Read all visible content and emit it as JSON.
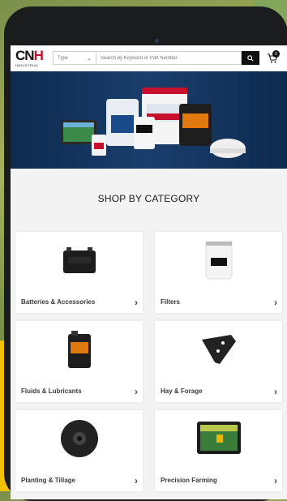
{
  "header": {
    "logo_text_a": "CN",
    "logo_text_b": "H",
    "logo_sub": "INDUSTRIAL",
    "type_label": "Type",
    "search_placeholder": "Search by Keyword or Part Number",
    "cart_count": "0"
  },
  "section": {
    "title": "SHOP BY CATEGORY"
  },
  "categories": [
    {
      "label": "Batteries & Accessories"
    },
    {
      "label": "Filters"
    },
    {
      "label": "Fluids & Lubricants"
    },
    {
      "label": "Hay & Forage"
    },
    {
      "label": "Planting & Tillage"
    },
    {
      "label": "Precision Farming"
    }
  ],
  "colors": {
    "brand_red": "#c8102e",
    "hero_blue": "#0e2a4f",
    "device_frame": "#1b1c1e"
  }
}
